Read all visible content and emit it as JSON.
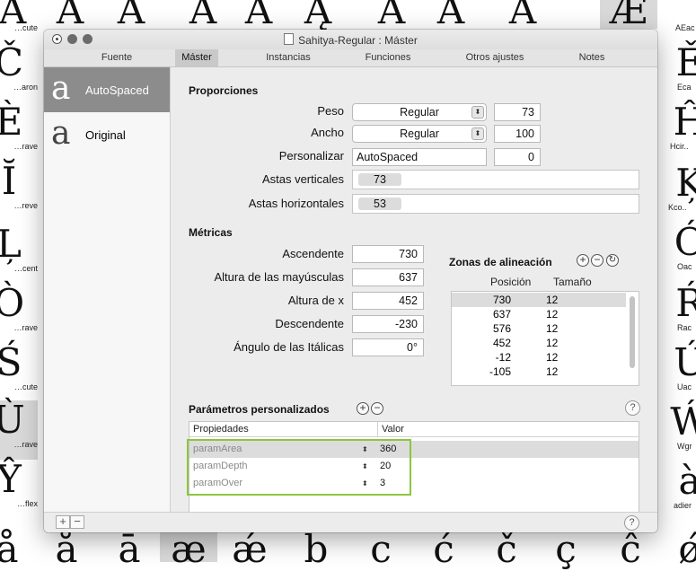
{
  "background_glyphs": {
    "left": [
      {
        "glyph": "Á",
        "name": "…cute"
      },
      {
        "glyph": "Č",
        "name": "…aron"
      },
      {
        "glyph": "È",
        "name": "…rave"
      },
      {
        "glyph": "Ĭ",
        "name": "…reve"
      },
      {
        "glyph": "Ļ",
        "name": "…cent"
      },
      {
        "glyph": "Ò",
        "name": "…rave"
      },
      {
        "glyph": "Ś",
        "name": "…cute"
      },
      {
        "glyph": "Ù",
        "name": "…rave"
      },
      {
        "glyph": "Ŷ",
        "name": "…flex"
      },
      {
        "glyph": "å",
        "name": ""
      }
    ],
    "right": [
      {
        "glyph": "Á",
        "name": "AEac"
      },
      {
        "glyph": "Ě",
        "name": "Eca"
      },
      {
        "glyph": "Ĥ",
        "name": "Hcir.."
      },
      {
        "glyph": "Ķ",
        "name": "Kco.."
      },
      {
        "glyph": "Ó",
        "name": "Oac"
      },
      {
        "glyph": "Ŕ",
        "name": "Rac"
      },
      {
        "glyph": "Ú",
        "name": "Uac"
      },
      {
        "glyph": "Ẃ",
        "name": "Wgr"
      },
      {
        "glyph": "à",
        "name": "adier"
      },
      {
        "glyph": "ǿ",
        "name": ""
      }
    ],
    "top": [
      "A",
      "A",
      "A",
      "A",
      "A",
      "Ą",
      "A",
      "A",
      "A",
      "Æ"
    ],
    "bottom": [
      "å",
      "ā",
      "æ",
      "ǽ",
      "b",
      "c",
      "ć",
      "č",
      "ç",
      "ĉ"
    ]
  },
  "window": {
    "title": "Sahitya-Regular : Máster",
    "tabs": [
      {
        "label": "Fuente",
        "active": false
      },
      {
        "label": "Máster",
        "active": true
      },
      {
        "label": "Instancias",
        "active": false
      },
      {
        "label": "Funciones",
        "active": false
      },
      {
        "label": "Otros ajustes",
        "active": false
      },
      {
        "label": "Notes",
        "active": false
      }
    ]
  },
  "sidebar": {
    "items": [
      {
        "glyph": "a",
        "label": "AutoSpaced",
        "active": true
      },
      {
        "glyph": "a",
        "label": "Original",
        "active": false
      }
    ]
  },
  "proporciones": {
    "header": "Proporciones",
    "peso_label": "Peso",
    "peso_select": "Regular",
    "peso_value": "73",
    "ancho_label": "Ancho",
    "ancho_select": "Regular",
    "ancho_value": "100",
    "personalizar_label": "Personalizar",
    "personalizar_value": "AutoSpaced",
    "personalizar_num": "0",
    "astas_v_label": "Astas verticales",
    "astas_v_value": "73",
    "astas_h_label": "Astas horizontales",
    "astas_h_value": "53"
  },
  "metricas": {
    "header": "Métricas",
    "rows": [
      {
        "label": "Ascendente",
        "value": "730"
      },
      {
        "label": "Altura de las mayúsculas",
        "value": "637"
      },
      {
        "label": "Altura de x",
        "value": "452"
      },
      {
        "label": "Descendente",
        "value": "-230"
      },
      {
        "label": "Ángulo de las Itálicas",
        "value": "0°"
      }
    ]
  },
  "zonas": {
    "header": "Zonas de alineación",
    "col_pos": "Posición",
    "col_size": "Tamaño",
    "rows": [
      {
        "pos": "730",
        "size": "12"
      },
      {
        "pos": "637",
        "size": "12"
      },
      {
        "pos": "576",
        "size": "12"
      },
      {
        "pos": "452",
        "size": "12"
      },
      {
        "pos": "-12",
        "size": "12"
      },
      {
        "pos": "-105",
        "size": "12"
      }
    ]
  },
  "parametros": {
    "header": "Parámetros personalizados",
    "col_prop": "Propiedades",
    "col_val": "Valor",
    "rows": [
      {
        "name": "paramArea",
        "value": "360"
      },
      {
        "name": "paramDepth",
        "value": "20"
      },
      {
        "name": "paramOver",
        "value": "3"
      }
    ]
  },
  "icons": {
    "add": "+",
    "remove": "−",
    "refresh": "↻",
    "help": "?",
    "stepper": "⬍"
  }
}
